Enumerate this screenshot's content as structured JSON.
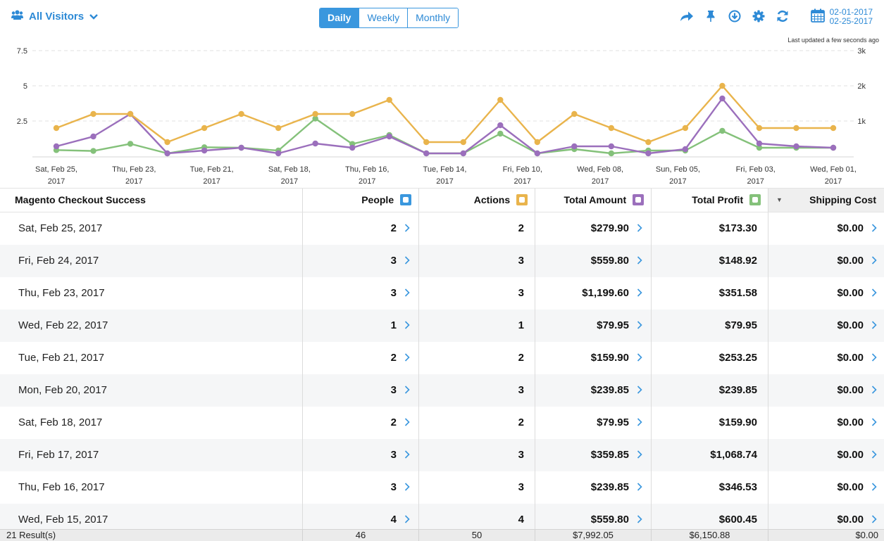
{
  "toolbar": {
    "segment_label": "All Visitors",
    "tabs": [
      {
        "label": "Daily",
        "active": true
      },
      {
        "label": "Weekly",
        "active": false
      },
      {
        "label": "Monthly",
        "active": false
      }
    ],
    "icons": [
      "share-icon",
      "pin-icon",
      "download-icon",
      "settings-icon",
      "refresh-icon",
      "calendar-icon"
    ],
    "date_from": "02-01-2017",
    "date_to": "02-25-2017",
    "accent_color": "#3a97de"
  },
  "chart_data": {
    "type": "line",
    "last_updated": "Last updated a few seconds ago",
    "left_ticks": [
      "7.5",
      "5",
      "2.5"
    ],
    "right_ticks": [
      "3k",
      "2k",
      "1k"
    ],
    "ylim_left": [
      0,
      7.5
    ],
    "ylim_right": [
      0,
      3000
    ],
    "grid": true,
    "x_ticks": [
      [
        "Sat, Feb 25,",
        "2017"
      ],
      [
        "Thu, Feb 23,",
        "2017"
      ],
      [
        "Tue, Feb 21,",
        "2017"
      ],
      [
        "Sat, Feb 18,",
        "2017"
      ],
      [
        "Thu, Feb 16,",
        "2017"
      ],
      [
        "Tue, Feb 14,",
        "2017"
      ],
      [
        "Fri, Feb 10,",
        "2017"
      ],
      [
        "Wed, Feb 08,",
        "2017"
      ],
      [
        "Sun, Feb 05,",
        "2017"
      ],
      [
        "Fri, Feb 03,",
        "2017"
      ],
      [
        "Wed, Feb 01,",
        "2017"
      ]
    ],
    "categories": [
      "Feb 25",
      "Feb 24",
      "Feb 23",
      "Feb 22",
      "Feb 21",
      "Feb 20",
      "Feb 18",
      "Feb 17",
      "Feb 16",
      "Feb 15",
      "Feb 14",
      "Feb 13",
      "Feb 10",
      "Feb 09",
      "Feb 08",
      "Feb 07",
      "Feb 06",
      "Feb 05",
      "Feb 04",
      "Feb 03",
      "Feb 02",
      "Feb 01"
    ],
    "series": [
      {
        "key": "actions",
        "color": "#e9b44c",
        "axis": "left",
        "values": [
          2,
          3,
          3,
          1,
          2,
          3,
          2,
          3,
          3,
          4,
          1,
          1,
          4,
          1,
          3,
          2,
          1,
          2,
          5,
          2,
          2,
          2
        ]
      },
      {
        "key": "total_amount",
        "color": "#9b6fbc",
        "axis": "right",
        "values": [
          280,
          560,
          1200,
          80,
          160,
          240,
          80,
          360,
          240,
          560,
          80,
          80,
          880,
          80,
          280,
          280,
          80,
          200,
          1640,
          360,
          280,
          240
        ]
      },
      {
        "key": "total_profit",
        "color": "#84c17a",
        "axis": "right",
        "values": [
          173,
          149,
          352,
          80,
          253,
          240,
          160,
          1069,
          347,
          600,
          80,
          80,
          640,
          80,
          200,
          80,
          160,
          160,
          720,
          240,
          240,
          240
        ]
      }
    ]
  },
  "table": {
    "columns": [
      {
        "label": "Magento Checkout Success"
      },
      {
        "label": "People",
        "swatch": "#3a97de"
      },
      {
        "label": "Actions",
        "swatch": "#e9b44c"
      },
      {
        "label": "Total Amount",
        "swatch": "#9b6fbc"
      },
      {
        "label": "Total Profit",
        "swatch": "#84c17a"
      },
      {
        "label": "Shipping Cost"
      }
    ],
    "rows": [
      {
        "date": "Sat, Feb 25, 2017",
        "people": "2",
        "actions": "2",
        "amount": "$279.90",
        "profit": "$173.30",
        "shipping": "$0.00"
      },
      {
        "date": "Fri, Feb 24, 2017",
        "people": "3",
        "actions": "3",
        "amount": "$559.80",
        "profit": "$148.92",
        "shipping": "$0.00"
      },
      {
        "date": "Thu, Feb 23, 2017",
        "people": "3",
        "actions": "3",
        "amount": "$1,199.60",
        "profit": "$351.58",
        "shipping": "$0.00"
      },
      {
        "date": "Wed, Feb 22, 2017",
        "people": "1",
        "actions": "1",
        "amount": "$79.95",
        "profit": "$79.95",
        "shipping": "$0.00"
      },
      {
        "date": "Tue, Feb 21, 2017",
        "people": "2",
        "actions": "2",
        "amount": "$159.90",
        "profit": "$253.25",
        "shipping": "$0.00"
      },
      {
        "date": "Mon, Feb 20, 2017",
        "people": "3",
        "actions": "3",
        "amount": "$239.85",
        "profit": "$239.85",
        "shipping": "$0.00"
      },
      {
        "date": "Sat, Feb 18, 2017",
        "people": "2",
        "actions": "2",
        "amount": "$79.95",
        "profit": "$159.90",
        "shipping": "$0.00"
      },
      {
        "date": "Fri, Feb 17, 2017",
        "people": "3",
        "actions": "3",
        "amount": "$359.85",
        "profit": "$1,068.74",
        "shipping": "$0.00"
      },
      {
        "date": "Thu, Feb 16, 2017",
        "people": "3",
        "actions": "3",
        "amount": "$239.85",
        "profit": "$346.53",
        "shipping": "$0.00"
      },
      {
        "date": "Wed, Feb 15, 2017",
        "people": "4",
        "actions": "4",
        "amount": "$559.80",
        "profit": "$600.45",
        "shipping": "$0.00"
      }
    ],
    "footer": {
      "results": "21 Result(s)",
      "people": "46",
      "actions": "50",
      "amount": "$7,992.05",
      "profit": "$6,150.88",
      "shipping": "$0.00"
    }
  }
}
